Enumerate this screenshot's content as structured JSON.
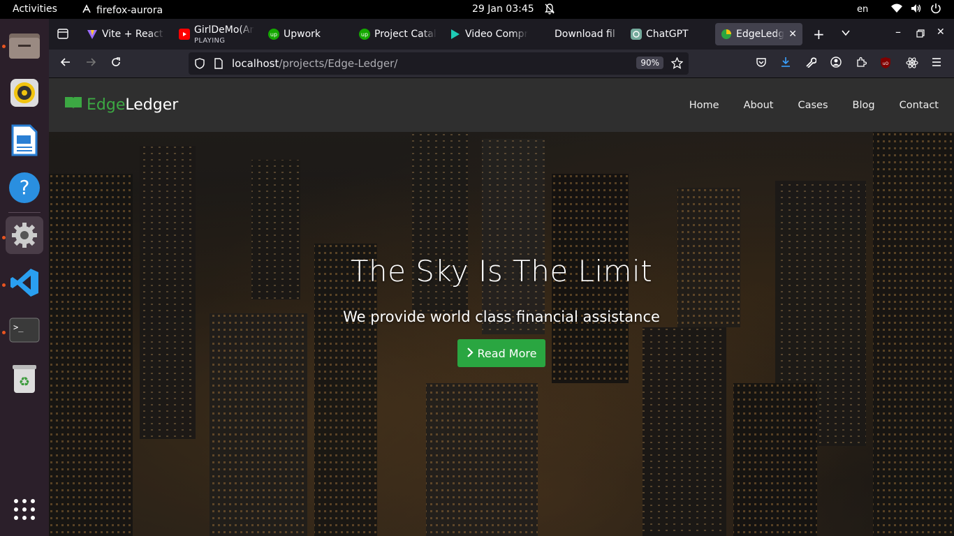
{
  "topbar": {
    "activities": "Activities",
    "app_name": "firefox-aurora",
    "clock": "29 Jan  03:45",
    "lang": "en"
  },
  "tabs": [
    {
      "label": "Vite + React",
      "icon": "vite-icon"
    },
    {
      "label": "GirlDeMo(An",
      "sub": "PLAYING",
      "icon": "youtube-icon"
    },
    {
      "label": "Upwork",
      "icon": "upwork-icon"
    },
    {
      "label": "Project Catal",
      "icon": "upwork-icon"
    },
    {
      "label": "Video Compr",
      "icon": "play-icon"
    },
    {
      "label": "Download fil",
      "icon": ""
    },
    {
      "label": "ChatGPT",
      "icon": "chatgpt-icon"
    },
    {
      "label": "EdgeLedge",
      "icon": "edgeledger-icon",
      "selected": true
    }
  ],
  "urlbar": {
    "host": "localhost",
    "path": "/projects/Edge-Ledger/",
    "zoom": "90%"
  },
  "site": {
    "brand_edge": "Edge",
    "brand_ledger": "Ledger",
    "menu": [
      "Home",
      "About",
      "Cases",
      "Blog",
      "Contact"
    ],
    "hero_title": "The Sky Is The Limit",
    "hero_subtitle": "We provide world class financial assistance",
    "cta": "Read More",
    "brand_color": "#3ca843",
    "cta_color": "#2aa641"
  }
}
